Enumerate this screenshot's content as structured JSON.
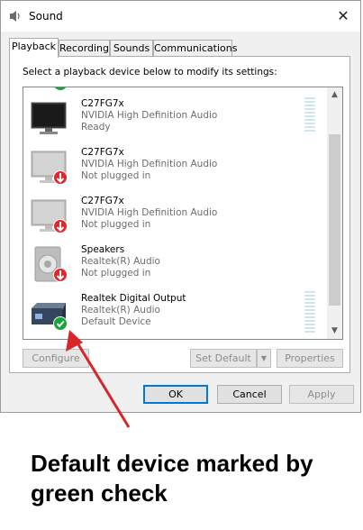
{
  "window": {
    "title": "Sound",
    "close_glyph": "✕",
    "icon": "speaker-icon"
  },
  "tabs": [
    {
      "label": "Playback",
      "active": true
    },
    {
      "label": "Recording",
      "active": false
    },
    {
      "label": "Sounds",
      "active": false
    },
    {
      "label": "Communications",
      "active": false
    }
  ],
  "instruction": "Select a playback device below to modify its settings:",
  "devices": [
    {
      "name": "C27FG7x",
      "driver": "NVIDIA High Definition Audio",
      "status": "Ready",
      "icon": "monitor-icon",
      "badge": "none"
    },
    {
      "name": "C27FG7x",
      "driver": "NVIDIA High Definition Audio",
      "status": "Not plugged in",
      "icon": "monitor-icon",
      "badge": "red-down-arrow"
    },
    {
      "name": "C27FG7x",
      "driver": "NVIDIA High Definition Audio",
      "status": "Not plugged in",
      "icon": "monitor-icon",
      "badge": "red-down-arrow"
    },
    {
      "name": "Speakers",
      "driver": "Realtek(R) Audio",
      "status": "Not plugged in",
      "icon": "speaker-icon",
      "badge": "red-down-arrow"
    },
    {
      "name": "Realtek Digital Output",
      "driver": "Realtek(R) Audio",
      "status": "Default Device",
      "icon": "digital-output-icon",
      "badge": "green-check"
    }
  ],
  "buttons": {
    "configure": "Configure",
    "set_default": "Set Default",
    "properties": "Properties",
    "ok": "OK",
    "cancel": "Cancel",
    "apply": "Apply"
  },
  "annotation": {
    "caption": "Default device marked by green check",
    "arrow_color": "#d8262b"
  },
  "colors": {
    "check": "#17a53a",
    "unplugged": "#e0272b",
    "accent": "#0078d7"
  }
}
